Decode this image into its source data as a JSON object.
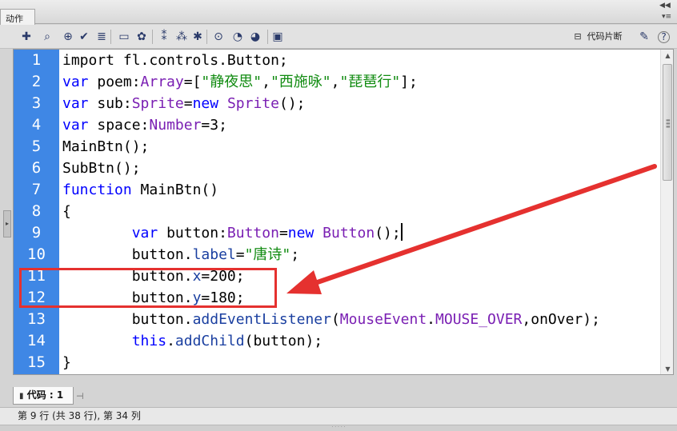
{
  "panel": {
    "tab_label": "动作",
    "collapse_glyph": "◀◀",
    "menu_glyph": "▾≡"
  },
  "toolbar": {
    "icons": [
      {
        "name": "add-statement-icon",
        "glyph": "✚"
      },
      {
        "name": "find-icon",
        "glyph": "⌕"
      },
      {
        "name": "insert-target-path-icon",
        "glyph": "⊕"
      },
      {
        "name": "check-syntax-icon",
        "glyph": "✔"
      },
      {
        "name": "auto-format-icon",
        "glyph": "≣"
      },
      {
        "name": "show-code-hint-icon",
        "glyph": "▭"
      },
      {
        "name": "debug-options-icon",
        "glyph": "✿"
      },
      {
        "name": "collapse-between-braces-icon",
        "glyph": "⁑"
      },
      {
        "name": "collapse-selection-icon",
        "glyph": "⁂"
      },
      {
        "name": "expand-all-icon",
        "glyph": "✱"
      },
      {
        "name": "apply-block-comment-icon",
        "glyph": "⊙"
      },
      {
        "name": "apply-line-comment-icon",
        "glyph": "◔"
      },
      {
        "name": "remove-comment-icon",
        "glyph": "◕"
      },
      {
        "name": "show-hide-toolbox-icon",
        "glyph": "▣"
      }
    ],
    "code_snippets_label": "代码片断",
    "snippet_icon": "⊟",
    "wizard_icon": "✎",
    "help_icon": "?"
  },
  "editor": {
    "lines": [
      {
        "num": "1",
        "tokens": [
          {
            "t": "import fl.controls.Button;",
            "c": ""
          }
        ]
      },
      {
        "num": "2",
        "tokens": [
          {
            "t": "var ",
            "c": "kw"
          },
          {
            "t": "poem:",
            "c": ""
          },
          {
            "t": "Array",
            "c": "ty"
          },
          {
            "t": "=[",
            "c": ""
          },
          {
            "t": "\"静夜思\"",
            "c": "st"
          },
          {
            "t": ",",
            "c": ""
          },
          {
            "t": "\"西施咏\"",
            "c": "st"
          },
          {
            "t": ",",
            "c": ""
          },
          {
            "t": "\"琵琶行\"",
            "c": "st"
          },
          {
            "t": "];",
            "c": ""
          }
        ]
      },
      {
        "num": "3",
        "tokens": [
          {
            "t": "var ",
            "c": "kw"
          },
          {
            "t": "sub:",
            "c": ""
          },
          {
            "t": "Sprite",
            "c": "ty"
          },
          {
            "t": "=",
            "c": ""
          },
          {
            "t": "new ",
            "c": "kw"
          },
          {
            "t": "Sprite",
            "c": "ty"
          },
          {
            "t": "();",
            "c": ""
          }
        ]
      },
      {
        "num": "4",
        "tokens": [
          {
            "t": "var ",
            "c": "kw"
          },
          {
            "t": "space:",
            "c": ""
          },
          {
            "t": "Number",
            "c": "ty"
          },
          {
            "t": "=3;",
            "c": ""
          }
        ]
      },
      {
        "num": "5",
        "tokens": [
          {
            "t": "MainBtn();",
            "c": ""
          }
        ]
      },
      {
        "num": "6",
        "tokens": [
          {
            "t": "SubBtn();",
            "c": ""
          }
        ]
      },
      {
        "num": "7",
        "tokens": [
          {
            "t": "function ",
            "c": "kw"
          },
          {
            "t": "MainBtn()",
            "c": ""
          }
        ]
      },
      {
        "num": "8",
        "tokens": [
          {
            "t": "{",
            "c": ""
          }
        ]
      },
      {
        "num": "9",
        "tokens": [
          {
            "t": "        ",
            "c": ""
          },
          {
            "t": "var ",
            "c": "kw"
          },
          {
            "t": "button:",
            "c": ""
          },
          {
            "t": "Button",
            "c": "ty"
          },
          {
            "t": "=",
            "c": ""
          },
          {
            "t": "new ",
            "c": "kw"
          },
          {
            "t": "Button",
            "c": "ty"
          },
          {
            "t": "();",
            "c": ""
          }
        ],
        "cursor": true
      },
      {
        "num": "10",
        "tokens": [
          {
            "t": "        ",
            "c": ""
          },
          {
            "t": "button.",
            "c": ""
          },
          {
            "t": "label",
            "c": "pr"
          },
          {
            "t": "=",
            "c": ""
          },
          {
            "t": "\"唐诗\"",
            "c": "st"
          },
          {
            "t": ";",
            "c": ""
          }
        ]
      },
      {
        "num": "11",
        "tokens": [
          {
            "t": "        ",
            "c": ""
          },
          {
            "t": "button.",
            "c": ""
          },
          {
            "t": "x",
            "c": "pr"
          },
          {
            "t": "=200;",
            "c": ""
          }
        ]
      },
      {
        "num": "12",
        "tokens": [
          {
            "t": "        ",
            "c": ""
          },
          {
            "t": "button.",
            "c": ""
          },
          {
            "t": "y",
            "c": "pr"
          },
          {
            "t": "=180;",
            "c": ""
          }
        ]
      },
      {
        "num": "13",
        "tokens": [
          {
            "t": "        ",
            "c": ""
          },
          {
            "t": "button.",
            "c": ""
          },
          {
            "t": "addEventListener",
            "c": "pr"
          },
          {
            "t": "(",
            "c": ""
          },
          {
            "t": "MouseEvent",
            "c": "ty"
          },
          {
            "t": ".",
            "c": ""
          },
          {
            "t": "MOUSE_OVER",
            "c": "ty"
          },
          {
            "t": ",onOver);",
            "c": ""
          }
        ]
      },
      {
        "num": "14",
        "tokens": [
          {
            "t": "        ",
            "c": ""
          },
          {
            "t": "this",
            "c": "kw"
          },
          {
            "t": ".",
            "c": ""
          },
          {
            "t": "addChild",
            "c": "pr"
          },
          {
            "t": "(button);",
            "c": ""
          }
        ]
      },
      {
        "num": "15",
        "tokens": [
          {
            "t": "}",
            "c": ""
          }
        ]
      }
    ]
  },
  "file_tab": {
    "label": "代码 : 1",
    "icon": "▮",
    "pin_icon": "⊣"
  },
  "status": {
    "text": "第 9 行 (共 38 行), 第 34 列"
  },
  "colors": {
    "gutter": "#3f87e5",
    "keyword": "#0000ff",
    "type": "#7a1fb3",
    "string": "#108b10",
    "annotation": "#e5312f"
  }
}
